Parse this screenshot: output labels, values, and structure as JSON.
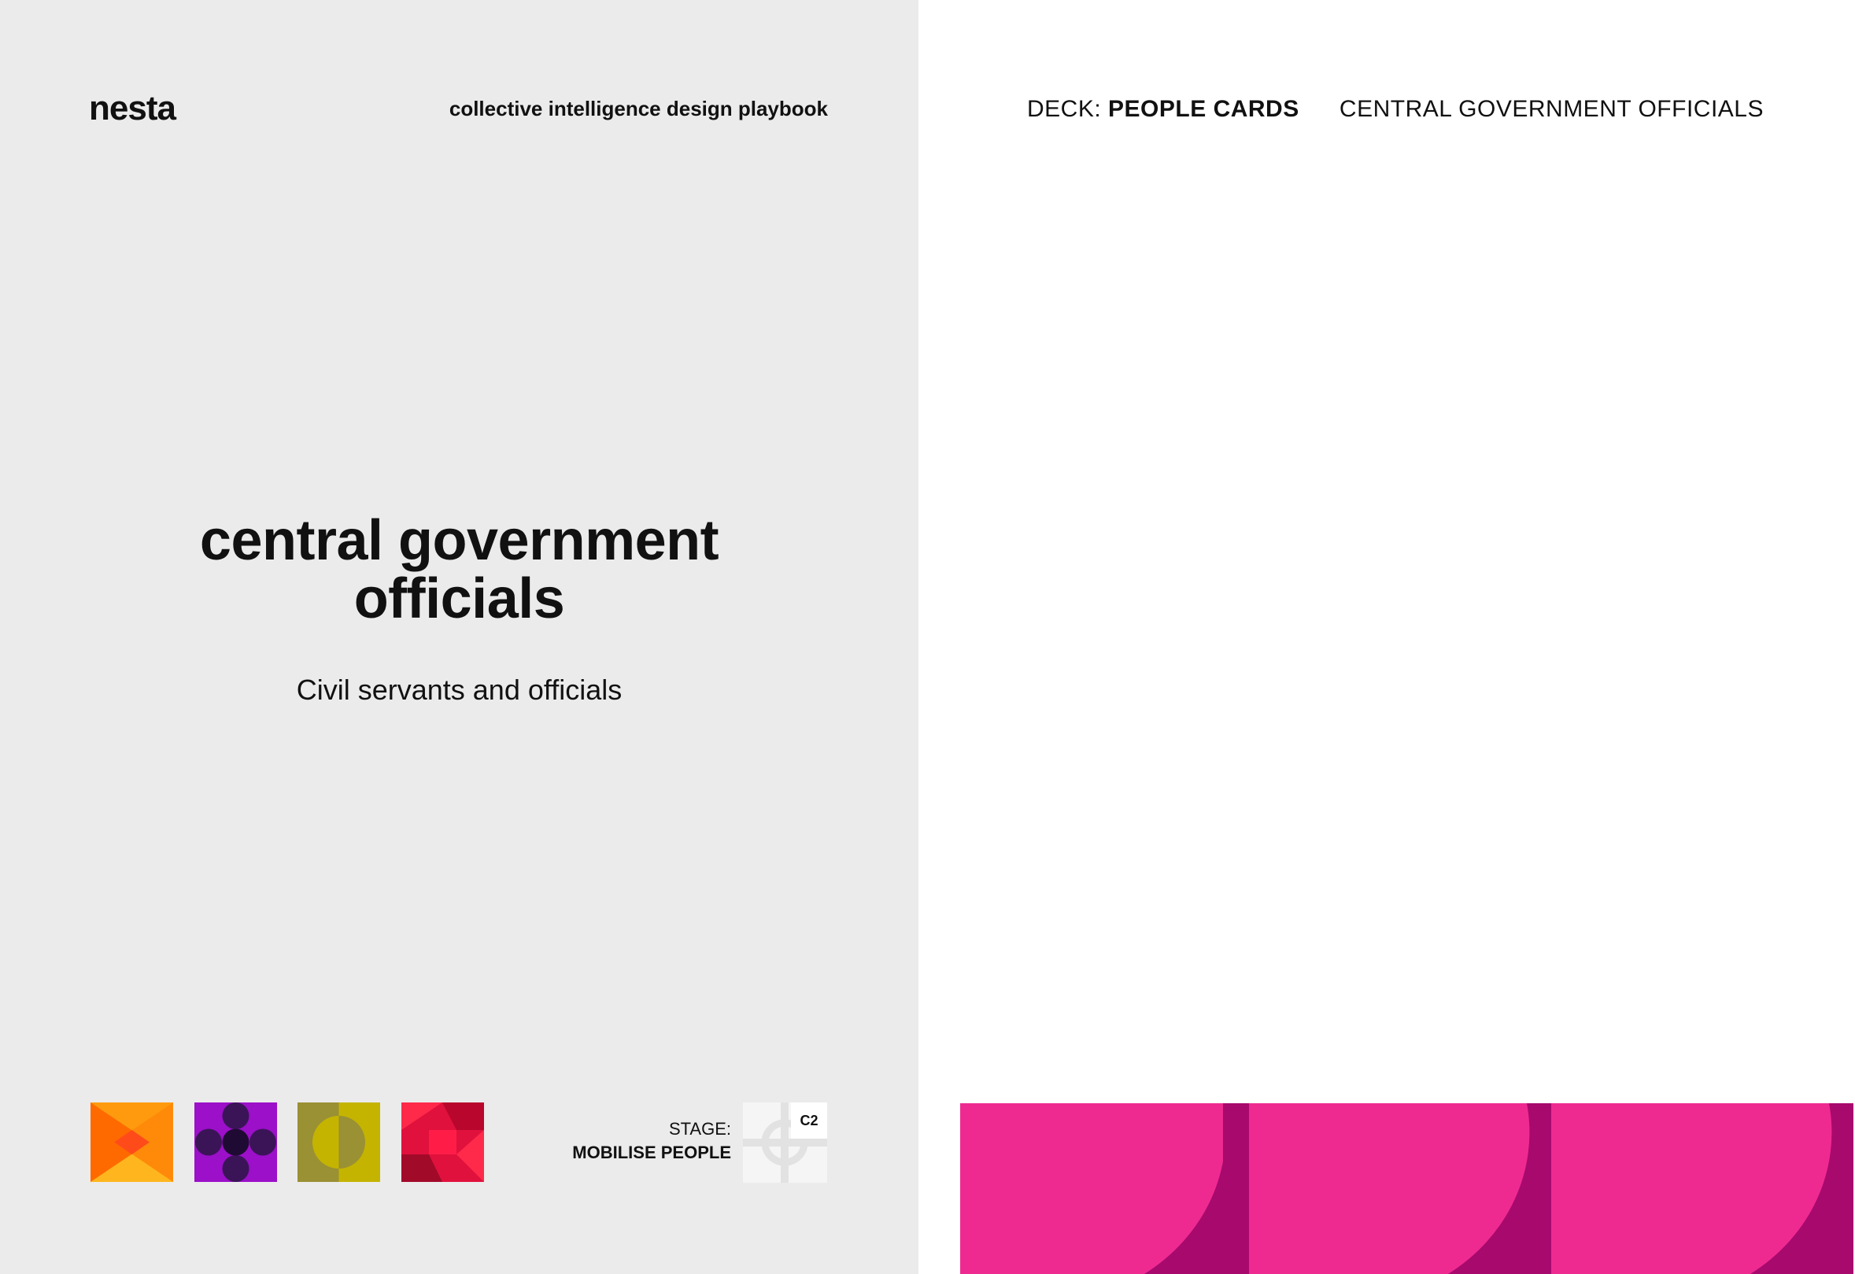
{
  "front": {
    "logo": "nesta",
    "playbook_title": "collective intelligence design playbook",
    "title_line1": "central government",
    "title_line2": "officials",
    "subtitle": "Civil servants and officials",
    "stage_label": "STAGE:",
    "stage_value": "MOBILISE PEOPLE",
    "stage_code": "C2",
    "icons": [
      "orange-bowtie-icon",
      "purple-flower-icon",
      "olive-circle-icon",
      "red-pinwheel-icon"
    ]
  },
  "back": {
    "deck_prefix": "DECK: ",
    "deck_name": "PEOPLE CARDS",
    "card_name": "CENTRAL GOVERNMENT OFFICIALS",
    "band_colors": {
      "light": "#ee2a91",
      "dark": "#a8096d"
    }
  },
  "colors": {
    "front_background": "#ebebeb",
    "back_background": "#ffffff"
  }
}
